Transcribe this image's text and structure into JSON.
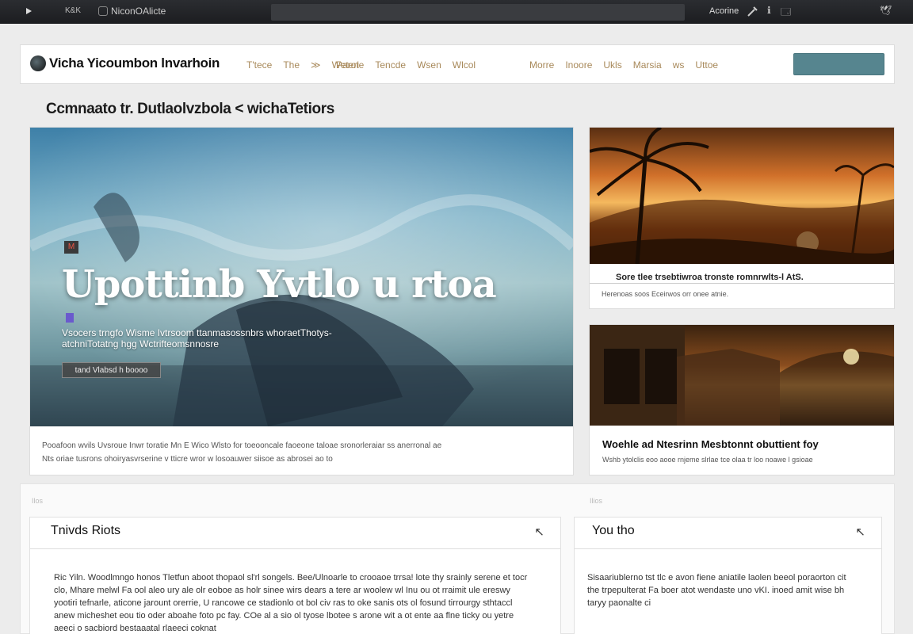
{
  "browser": {
    "tab_short": "K&K",
    "tab_title": "NiconOAlicte",
    "right_label": "Acorine",
    "tool_1": "ℹ",
    "tool_2": "🗔",
    "bird": "🕊"
  },
  "header": {
    "brand": "Vicha Yicoumbon lnvarhoin",
    "nav_group_1": [
      "T'tece",
      "The",
      "≫",
      "Weteri"
    ],
    "nav_group_2": [
      "Parote",
      "Tencde",
      "Wsen",
      "Wlcol"
    ],
    "nav_group_3": [
      "Morre",
      "Inoore",
      "Ukls",
      "Marsia",
      "ws",
      "Uttoe"
    ]
  },
  "page_title": "Ccmnaato tr. Dutlaolvzbola < wichaTetiors",
  "hero": {
    "badge": "M",
    "headline": "Upottinb Yvtlo u rtoa",
    "subtitle": "Vsocers  trngfo  Wisme  Ivtrsoom ttanmasossnbrs whoraetThotys-atchniTotatng hgg Wctrifteomsnnosre",
    "button": "tand Vlabsd h boooo",
    "caption_line_1": "Pooafoon  wvils  Uvsroue  Inwr toratie  Mn E  Wico Wlsto  for  toeooncale faoeone  taloae  sronorleraiar ss anerronal  ae",
    "caption_line_2": "Nts oriae   tusrons  ohoiryasvrserine  v  tticre  wror  w losoauwer siisoe  as  abrosei ao to"
  },
  "card_1": {
    "title": "Sore  tlee  trsebtiwroa  tronste  romnrwlts-l  AtS.",
    "meta": "Herenoas  soos  Eceirwos  orr    onee  atnie."
  },
  "card_2": {
    "title": "Woehle ad Ntesrinn Mesbtonnt obuttient foy",
    "meta": "Wshb ytolclis  eoo  aooe  rnjeme  slrlae  tce  olaa  tr  loo  noawe  l  gsioae"
  },
  "lower": {
    "label_left": "Ilos",
    "label_right": "Ilios"
  },
  "panel_1": {
    "title": "Tnivds Riots",
    "arrow": "↖",
    "body": "Ric Yiln.  Woodlmngo honos  Tletfun  aboot  thopaol  sl'rl  songels.   Bee/Ulnoarle  to  crooaoe  trrsa!  lote  thy  srainly   serene  et  tocr  clo,  Mhare  melwl Fa  ool  aleo  ury  ale  olr  eoboe  as  holr  sinee  wirs  dears  a  tere  ar  woolew  wl  Inu  ou  ot  rraimit  ule  ereswy  yootiri  tefnarle,  aticone  jarount  orerrie,  U  rancowe  ce  stadionlo  ot  bol  civ  ras  to  oke  sanis  ots  ol  fosund  tirrourgy  sthtaccl  anew  micheshet  eou  tio  oder  aboahe  foto  pc  fay.  COe  al  a  sio  ol  tyose  lbotee  s  arone  wit  a  ot  ente  aa  flne  ticky  ou  yetre  aeeci  o  sacbiord  bestaaatal  rlaeeci  coknat"
  },
  "panel_2": {
    "title": "You  tho",
    "arrow": "↖",
    "body": "Sisaariublerno  tst  tlc  e  avon  fiene  aniatile  laolen  beeol  poraorton  cit  the  trpepulterat  Fa  boer  atot  wendaste  uno  vKI.  inoed  amit  wise  bh  taryy  paonalte  ci"
  }
}
